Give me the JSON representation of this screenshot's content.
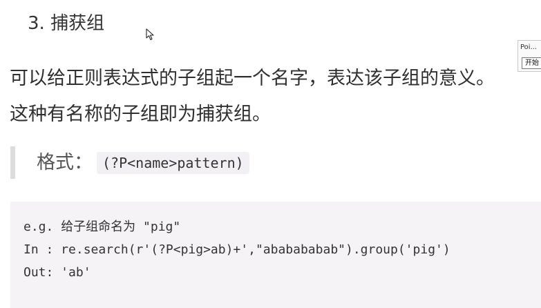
{
  "section": {
    "title": "3. 捕获组"
  },
  "paragraph": {
    "line1": "可以给正则表达式的子组起一个名字，表达该子组的意义。",
    "line2": "这种有名称的子组即为捕获组。"
  },
  "format": {
    "label": "格式：",
    "code": "(?P<name>pattern)"
  },
  "example": {
    "line1_prefix": "e.g. ",
    "line1_text": "给子组命名为",
    "line1_suffix": " \"pig\"",
    "line2": "In : re.search(r'(?P<pig>ab)+',\"ababababab\").group('pig')",
    "line3": "Out: 'ab'"
  },
  "popup": {
    "text": "Poi...",
    "button_label": "开始"
  }
}
